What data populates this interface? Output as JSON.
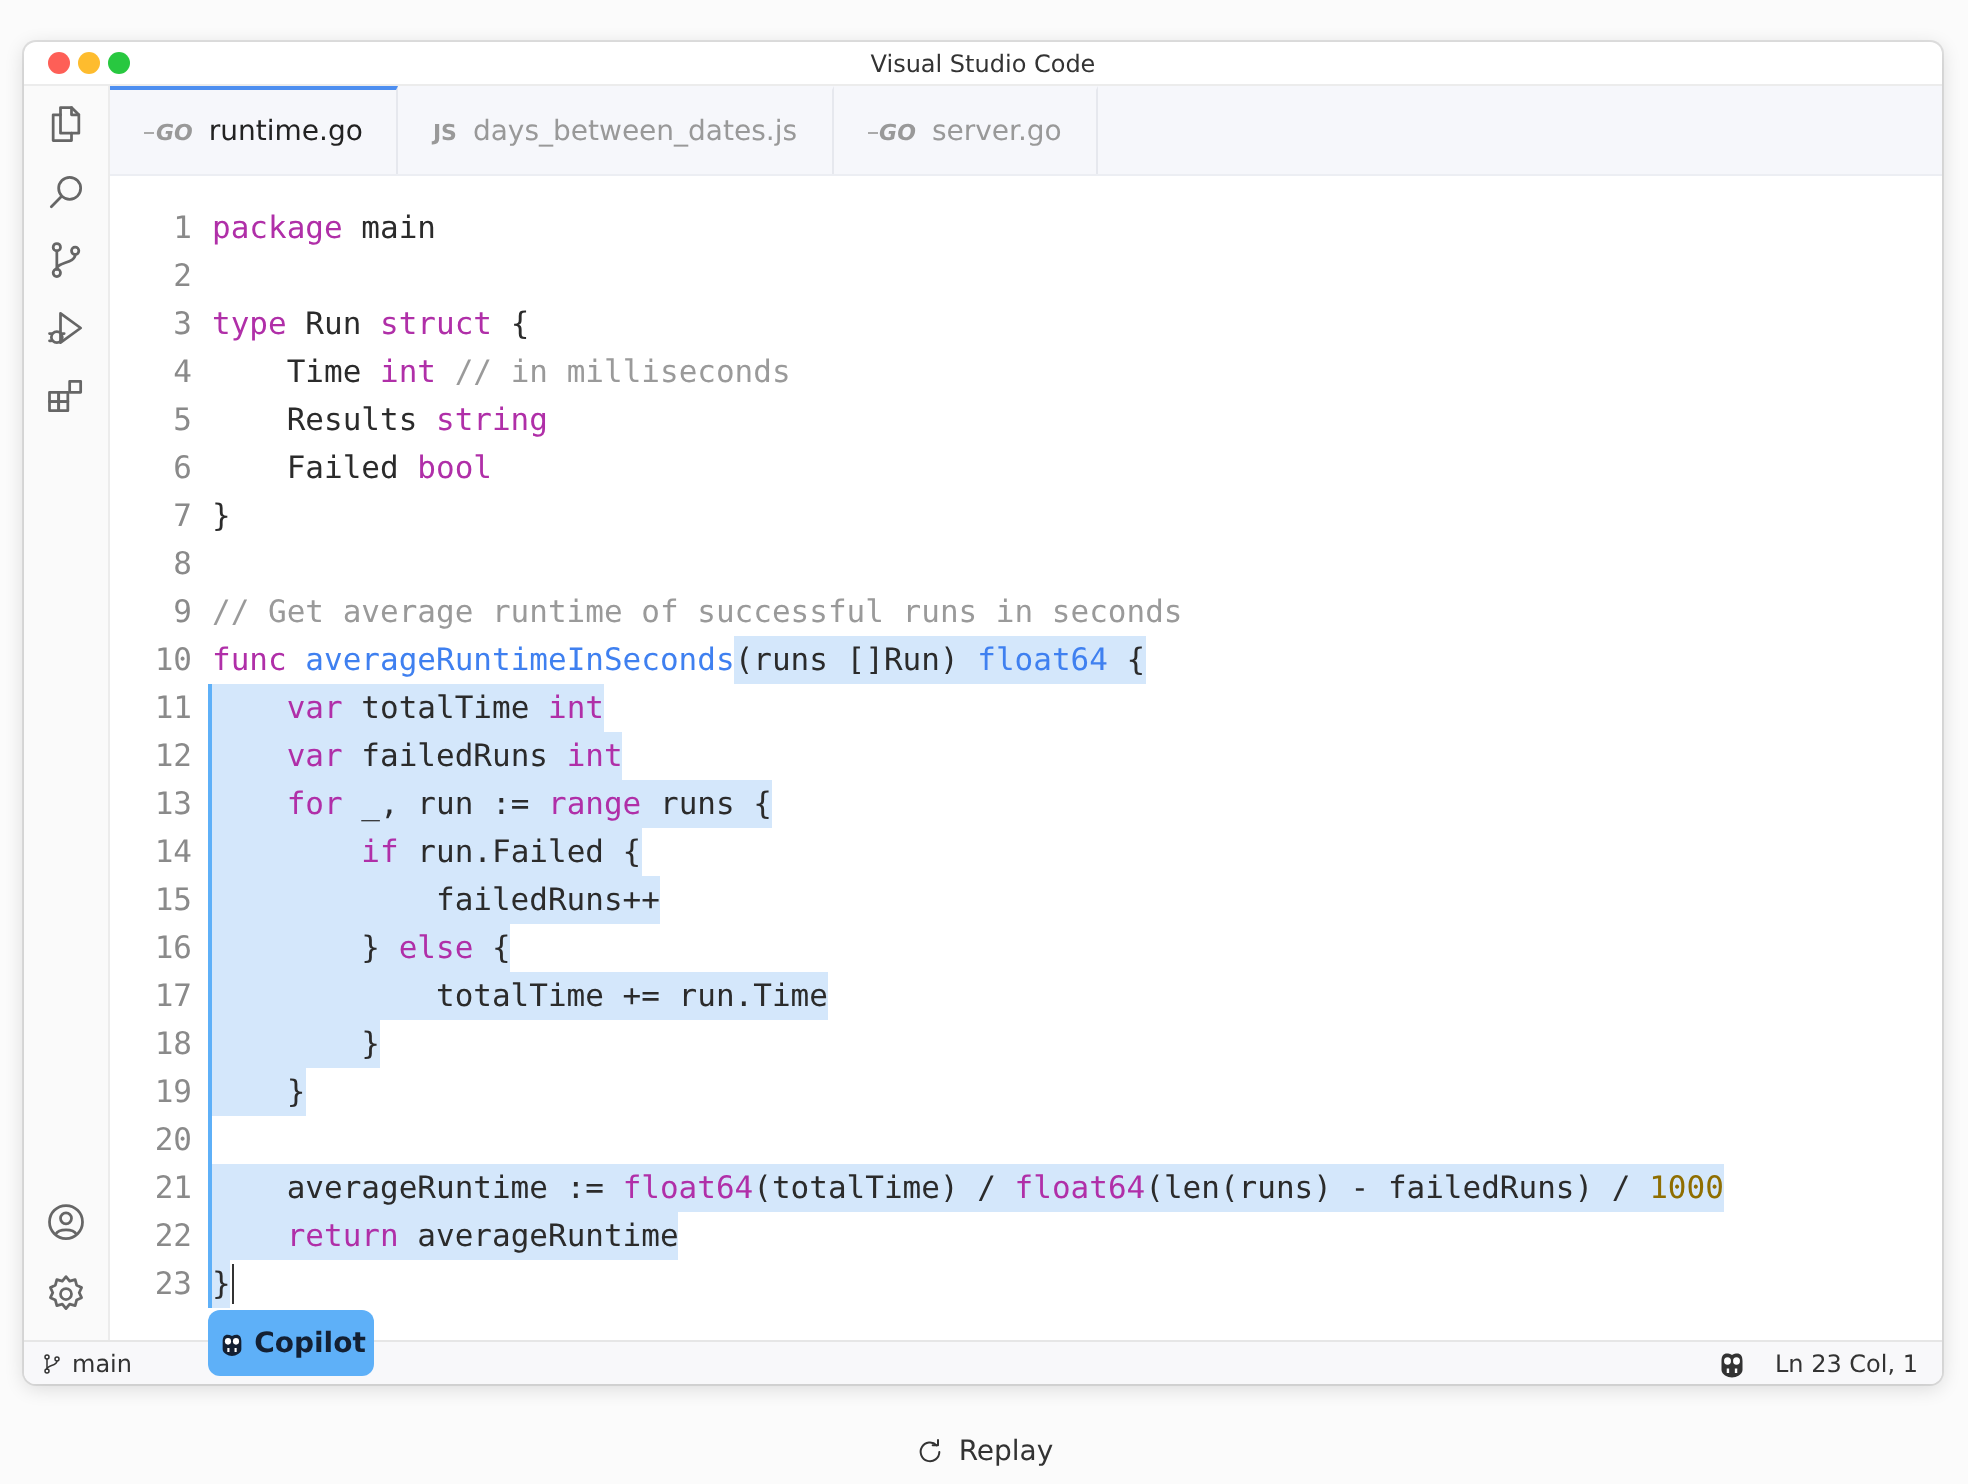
{
  "window": {
    "title": "Visual Studio Code"
  },
  "tabs": [
    {
      "label": "runtime.go",
      "icon": "GO",
      "kind": "go",
      "selected": true
    },
    {
      "label": "days_between_dates.js",
      "icon": "JS",
      "kind": "js",
      "selected": false
    },
    {
      "label": "server.go",
      "icon": "GO",
      "kind": "go",
      "selected": false
    }
  ],
  "editor": {
    "lines": [
      {
        "number": "1",
        "in_suggestion": false,
        "caret": false,
        "segments": [
          {
            "selected": false,
            "tokens": [
              {
                "kind": "keyword",
                "text": "package"
              },
              {
                "kind": "plain",
                "text": " main"
              }
            ]
          }
        ]
      },
      {
        "number": "2",
        "in_suggestion": false,
        "caret": false
      },
      {
        "number": "3",
        "in_suggestion": false,
        "caret": false,
        "segments": [
          {
            "selected": false,
            "tokens": [
              {
                "kind": "keyword",
                "text": "type"
              },
              {
                "kind": "plain",
                "text": " Run "
              },
              {
                "kind": "keyword",
                "text": "struct"
              },
              {
                "kind": "plain",
                "text": " {"
              }
            ]
          }
        ]
      },
      {
        "number": "4",
        "in_suggestion": false,
        "caret": false,
        "segments": [
          {
            "selected": false,
            "tokens": [
              {
                "kind": "plain",
                "text": "    Time "
              },
              {
                "kind": "keyword",
                "text": "int"
              },
              {
                "kind": "comment",
                "text": " // in milliseconds"
              }
            ]
          }
        ]
      },
      {
        "number": "5",
        "in_suggestion": false,
        "caret": false,
        "segments": [
          {
            "selected": false,
            "tokens": [
              {
                "kind": "plain",
                "text": "    Results "
              },
              {
                "kind": "keyword",
                "text": "string"
              }
            ]
          }
        ]
      },
      {
        "number": "6",
        "in_suggestion": false,
        "caret": false,
        "segments": [
          {
            "selected": false,
            "tokens": [
              {
                "kind": "plain",
                "text": "    Failed "
              },
              {
                "kind": "keyword",
                "text": "bool"
              }
            ]
          }
        ]
      },
      {
        "number": "7",
        "in_suggestion": false,
        "caret": false,
        "segments": [
          {
            "selected": false,
            "tokens": [
              {
                "kind": "plain",
                "text": "}"
              }
            ]
          }
        ]
      },
      {
        "number": "8",
        "in_suggestion": false,
        "caret": false
      },
      {
        "number": "9",
        "in_suggestion": false,
        "caret": false,
        "segments": [
          {
            "selected": false,
            "tokens": [
              {
                "kind": "comment",
                "text": "// Get average runtime of successful runs in seconds"
              }
            ]
          }
        ]
      },
      {
        "number": "10",
        "in_suggestion": false,
        "caret": false,
        "segments": [
          {
            "selected": false,
            "tokens": [
              {
                "kind": "keyword",
                "text": "func "
              },
              {
                "kind": "function",
                "text": "averageRuntimeInSeconds"
              }
            ]
          },
          {
            "selected": true,
            "tokens": [
              {
                "kind": "plain",
                "text": "(runs []Run) "
              },
              {
                "kind": "function",
                "text": "float64"
              },
              {
                "kind": "plain",
                "text": " {"
              }
            ]
          }
        ]
      },
      {
        "number": "11",
        "in_suggestion": true,
        "caret": false,
        "segments": [
          {
            "selected": true,
            "tokens": [
              {
                "kind": "keyword",
                "text": "    var"
              },
              {
                "kind": "plain",
                "text": " totalTime "
              },
              {
                "kind": "keyword",
                "text": "int"
              }
            ]
          }
        ]
      },
      {
        "number": "12",
        "in_suggestion": true,
        "caret": false,
        "segments": [
          {
            "selected": true,
            "tokens": [
              {
                "kind": "keyword",
                "text": "    var"
              },
              {
                "kind": "plain",
                "text": " failedRuns "
              },
              {
                "kind": "keyword",
                "text": "int"
              }
            ]
          }
        ]
      },
      {
        "number": "13",
        "in_suggestion": true,
        "caret": false,
        "segments": [
          {
            "selected": true,
            "tokens": [
              {
                "kind": "keyword",
                "text": "    for"
              },
              {
                "kind": "plain",
                "text": " _, run := "
              },
              {
                "kind": "keyword",
                "text": "range"
              },
              {
                "kind": "plain",
                "text": " runs {"
              }
            ]
          }
        ]
      },
      {
        "number": "14",
        "in_suggestion": true,
        "caret": false,
        "segments": [
          {
            "selected": true,
            "tokens": [
              {
                "kind": "keyword",
                "text": "        if"
              },
              {
                "kind": "plain",
                "text": " run.Failed {"
              }
            ]
          }
        ]
      },
      {
        "number": "15",
        "in_suggestion": true,
        "caret": false,
        "segments": [
          {
            "selected": true,
            "tokens": [
              {
                "kind": "plain",
                "text": "            failedRuns++"
              }
            ]
          }
        ]
      },
      {
        "number": "16",
        "in_suggestion": true,
        "caret": false,
        "segments": [
          {
            "selected": true,
            "tokens": [
              {
                "kind": "plain",
                "text": "        } "
              },
              {
                "kind": "keyword",
                "text": "else"
              },
              {
                "kind": "plain",
                "text": " {"
              }
            ]
          }
        ]
      },
      {
        "number": "17",
        "in_suggestion": true,
        "caret": false,
        "segments": [
          {
            "selected": true,
            "tokens": [
              {
                "kind": "plain",
                "text": "            totalTime += run.Time"
              }
            ]
          }
        ]
      },
      {
        "number": "18",
        "in_suggestion": true,
        "caret": false,
        "segments": [
          {
            "selected": true,
            "tokens": [
              {
                "kind": "plain",
                "text": "        }"
              }
            ]
          }
        ]
      },
      {
        "number": "19",
        "in_suggestion": true,
        "caret": false,
        "segments": [
          {
            "selected": true,
            "tokens": [
              {
                "kind": "plain",
                "text": "    }"
              }
            ]
          }
        ]
      },
      {
        "number": "20",
        "in_suggestion": true,
        "caret": false
      },
      {
        "number": "21",
        "in_suggestion": true,
        "caret": false,
        "segments": [
          {
            "selected": true,
            "tokens": [
              {
                "kind": "plain",
                "text": "    averageRuntime := "
              },
              {
                "kind": "keyword",
                "text": "float64"
              },
              {
                "kind": "plain",
                "text": "(totalTime) / "
              },
              {
                "kind": "keyword",
                "text": "float64"
              },
              {
                "kind": "plain",
                "text": "(len(runs) - failedRuns) / "
              },
              {
                "kind": "number",
                "text": "1000"
              }
            ]
          }
        ]
      },
      {
        "number": "22",
        "in_suggestion": true,
        "caret": false,
        "segments": [
          {
            "selected": true,
            "tokens": [
              {
                "kind": "keyword",
                "text": "    return"
              },
              {
                "kind": "plain",
                "text": " averageRuntime"
              }
            ]
          }
        ]
      },
      {
        "number": "23",
        "in_suggestion": true,
        "caret": true,
        "segments": [
          {
            "selected": true,
            "tokens": [
              {
                "kind": "plain",
                "text": "}"
              }
            ]
          }
        ]
      }
    ]
  },
  "copilot_badge": {
    "label": "Copilot"
  },
  "status_bar": {
    "branch": "main",
    "cursor_position": "Ln 23 Col, 1"
  },
  "replay_button": {
    "label": "Replay"
  }
}
